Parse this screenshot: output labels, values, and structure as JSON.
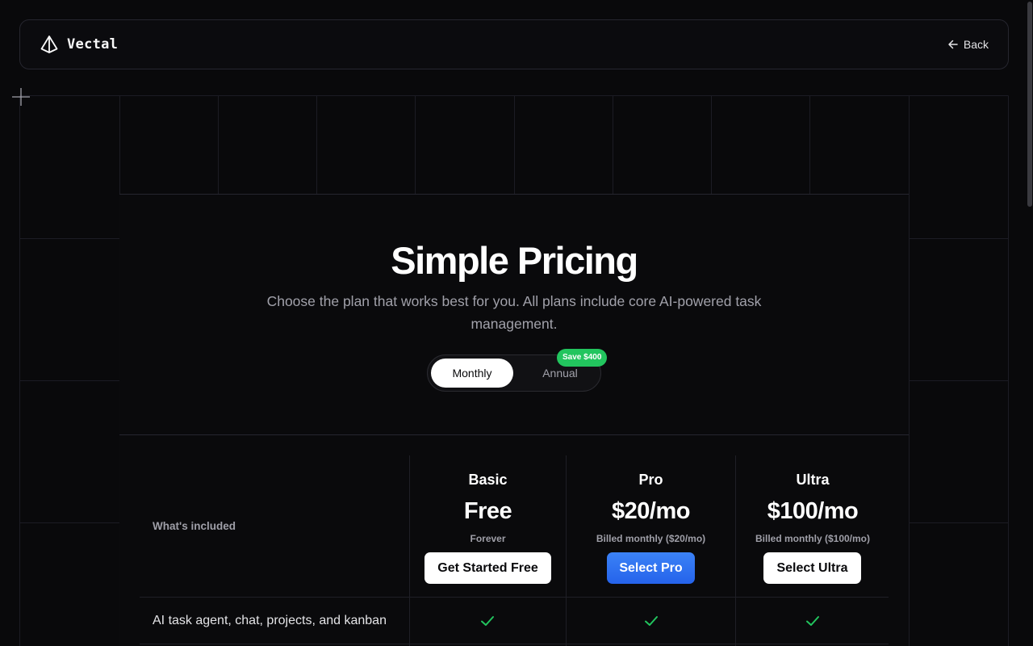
{
  "header": {
    "brand_name": "Vectal",
    "back_label": "Back"
  },
  "hero": {
    "title": "Simple Pricing",
    "subtitle": "Choose the plan that works best for you. All plans include core AI-powered task management."
  },
  "billing_toggle": {
    "monthly_label": "Monthly",
    "annual_label": "Annual",
    "save_badge": "Save $400",
    "selected": "Monthly"
  },
  "pricing": {
    "included_label": "What's included",
    "plans": [
      {
        "name": "Basic",
        "price": "Free",
        "note": "Forever",
        "button": "Get Started Free"
      },
      {
        "name": "Pro",
        "price": "$20/mo",
        "note": "Billed monthly ($20/mo)",
        "button": "Select Pro"
      },
      {
        "name": "Ultra",
        "price": "$100/mo",
        "note": "Billed monthly ($100/mo)",
        "button": "Select Ultra"
      }
    ],
    "features": [
      {
        "label": "AI task agent, chat, projects, and kanban",
        "basic": true,
        "pro": true,
        "ultra": true
      }
    ]
  },
  "colors": {
    "background": "#09090b",
    "accent_blue": "#2563eb",
    "check_green": "#22c55e",
    "badge_green": "#22c55e"
  },
  "icons": {
    "logo": "pyramid-logo-icon",
    "back": "arrow-left-icon",
    "check": "check-icon",
    "corner": "plus-icon"
  }
}
